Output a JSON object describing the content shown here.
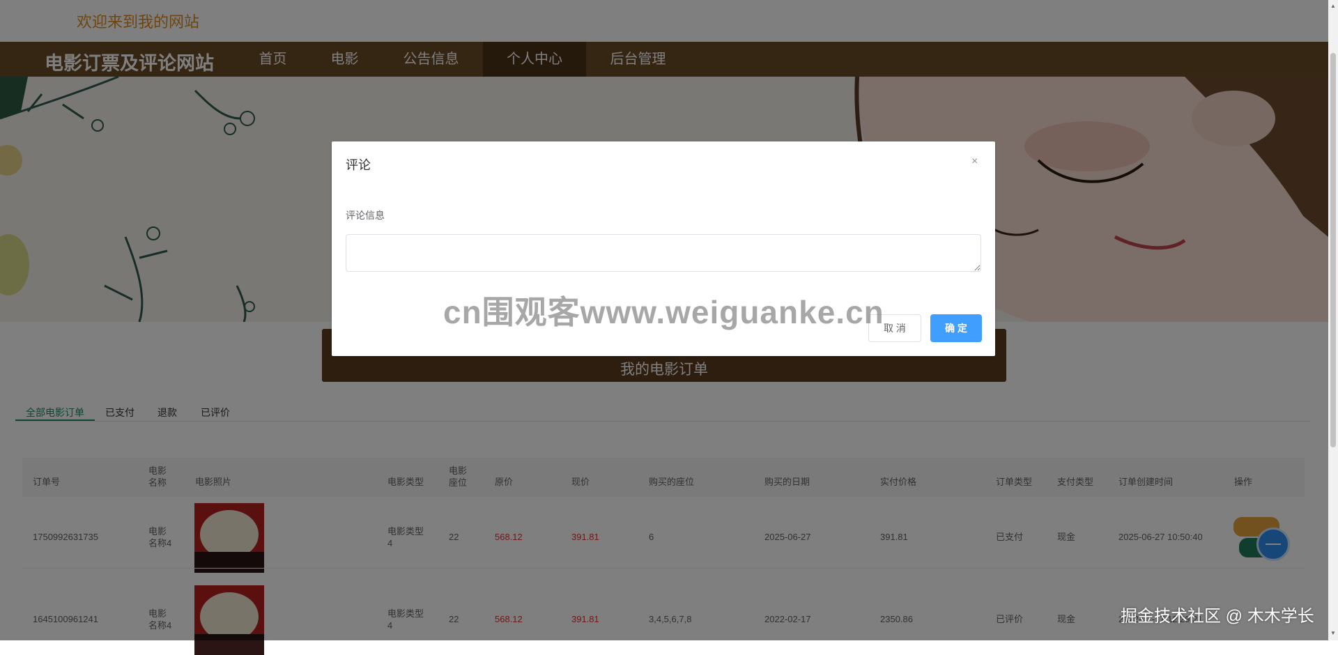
{
  "header": {
    "welcome": "欢迎来到我的网站"
  },
  "nav": {
    "site_title": "电影订票及评论网站",
    "items": [
      "首页",
      "电影",
      "公告信息",
      "个人中心",
      "后台管理"
    ],
    "active": "个人中心"
  },
  "page": {
    "title": "我的电影订单"
  },
  "tabs": [
    "全部电影订单",
    "已支付",
    "退款",
    "已评价"
  ],
  "table": {
    "headers": [
      "订单号",
      "电影\n名称",
      "电影照片",
      "电影类型",
      "电影\n座位",
      "原价",
      "现价",
      "购买的座位",
      "购买的日期",
      "实付价格",
      "订单类型",
      "支付类型",
      "订单创建时间",
      "操作"
    ],
    "rows": [
      {
        "order_no": "1750992631735",
        "movie_name": "电影\n名称4",
        "movie_type": "电影类型\n4",
        "seats_total": "22",
        "original_price": "568.12",
        "current_price": "391.81",
        "seats": "6",
        "date": "2025-06-27",
        "paid": "391.81",
        "order_type": "已支付",
        "pay_type": "现金",
        "created": "2025-06-27 10:50:40"
      },
      {
        "order_no": "1645100961241",
        "movie_name": "电影\n名称4",
        "movie_type": "电影类型\n4",
        "seats_total": "22",
        "original_price": "568.12",
        "current_price": "391.81",
        "seats": "3,4,5,6,7,8",
        "date": "2022-02-17",
        "paid": "2350.86",
        "order_type": "已评价",
        "pay_type": "现金",
        "created": "2022-02-17 12:29:21"
      }
    ]
  },
  "dialog": {
    "title": "评论",
    "close_icon": "×",
    "field_label": "评论信息",
    "field_value": "",
    "cancel_label": "取 消",
    "confirm_label": "确 定"
  },
  "watermark": "cn围观客www.weiguanke.cn",
  "corner_watermark": "掘金技术社区 @ 木木学长",
  "colors": {
    "nav_bg": "#6b4a26",
    "accent": "#409eff",
    "price": "#e33131",
    "tab_active": "#1f8a5c"
  }
}
